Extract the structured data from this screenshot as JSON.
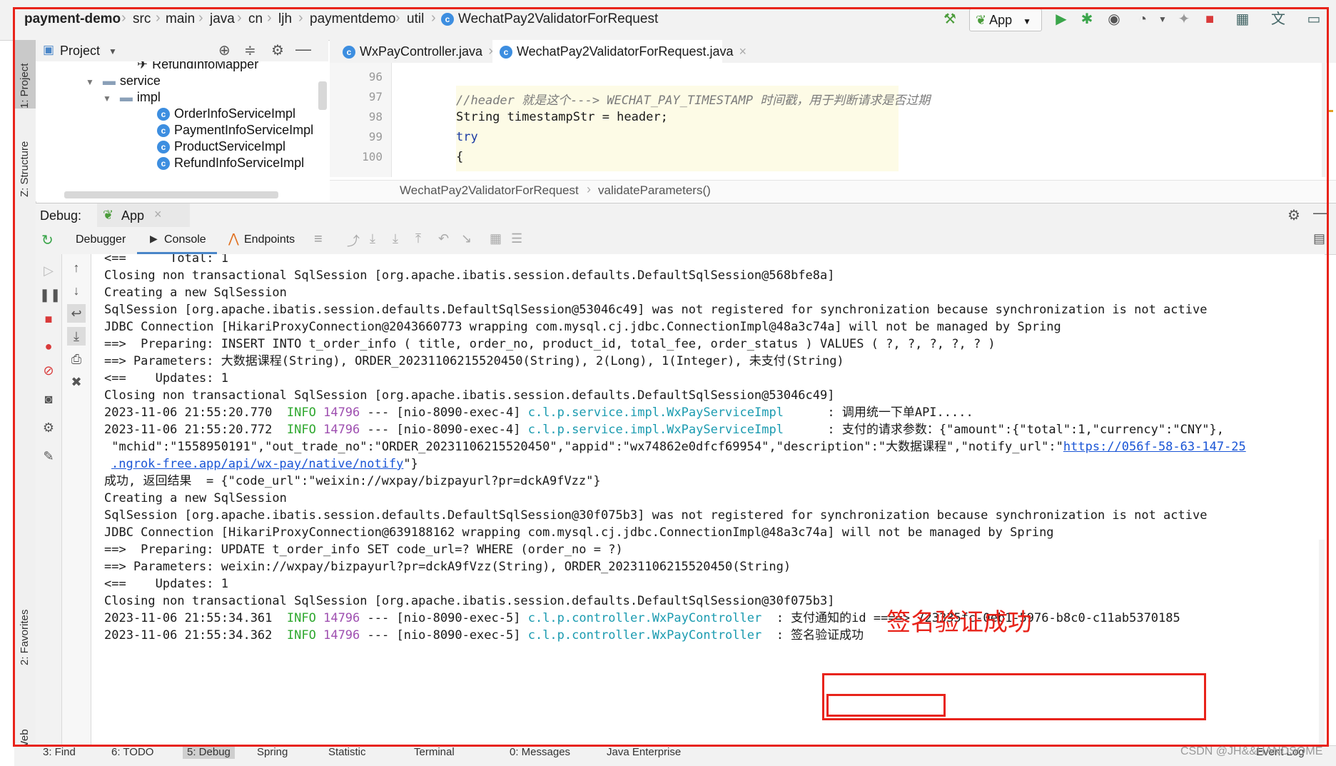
{
  "breadcrumb": [
    "payment-demo",
    "src",
    "main",
    "java",
    "cn",
    "ljh",
    "paymentdemo",
    "util",
    "WechatPay2ValidatorForRequest"
  ],
  "run_config": "App",
  "side_labels": {
    "project": "1: Project",
    "structure": "Z: Structure",
    "favorites": "2: Favorites",
    "web": "Web"
  },
  "project": {
    "header": "Project",
    "items": [
      {
        "label": "RefundInfoMapper",
        "kind": "mapper"
      },
      {
        "label": "service",
        "kind": "folder"
      },
      {
        "label": "impl",
        "kind": "folder"
      },
      {
        "label": "OrderInfoServiceImpl",
        "kind": "class"
      },
      {
        "label": "PaymentInfoServiceImpl",
        "kind": "class"
      },
      {
        "label": "ProductServiceImpl",
        "kind": "class"
      },
      {
        "label": "RefundInfoServiceImpl",
        "kind": "class"
      }
    ]
  },
  "editor": {
    "tabs": [
      "WxPayController.java",
      "WechatPay2ValidatorForRequest.java"
    ],
    "line_numbers": [
      "96",
      "97",
      "98",
      "99",
      "100"
    ],
    "code_lines": [
      "",
      "//header 就是这个---> WECHAT_PAY_TIMESTAMP 时间戳，用于判断请求是否过期",
      "String timestampStr = header;",
      "try",
      "{"
    ],
    "breadcrumb": [
      "WechatPay2ValidatorForRequest",
      "validateParameters()"
    ]
  },
  "debug": {
    "label": "Debug:",
    "session": "App",
    "tabs": [
      "Debugger",
      "Console",
      "Endpoints"
    ]
  },
  "console": {
    "lines": [
      "<==      Total: 1",
      "Closing non transactional SqlSession [org.apache.ibatis.session.defaults.DefaultSqlSession@568bfe8a]",
      "Creating a new SqlSession",
      "SqlSession [org.apache.ibatis.session.defaults.DefaultSqlSession@53046c49] was not registered for synchronization because synchronization is not active",
      "JDBC Connection [HikariProxyConnection@2043660773 wrapping com.mysql.cj.jdbc.ConnectionImpl@48a3c74a] will not be managed by Spring",
      "==>  Preparing: INSERT INTO t_order_info ( title, order_no, product_id, total_fee, order_status ) VALUES ( ?, ?, ?, ?, ? )",
      "==> Parameters: 大数据课程(String), ORDER_20231106215520450(String), 2(Long), 1(Integer), 未支付(String)",
      "<==    Updates: 1",
      "Closing non transactional SqlSession [org.apache.ibatis.session.defaults.DefaultSqlSession@53046c49]"
    ],
    "log1": {
      "time": "2023-11-06 21:55:20.770",
      "level": "INFO",
      "pid": "14796",
      "thread": "--- [nio-8090-exec-4]",
      "cls": "c.l.p.service.impl.WxPayServiceImpl",
      "msg": "      : 调用统一下单API....."
    },
    "log2": {
      "time": "2023-11-06 21:55:20.772",
      "level": "INFO",
      "pid": "14796",
      "thread": "--- [nio-8090-exec-4]",
      "cls": "c.l.p.service.impl.WxPayServiceImpl",
      "msg": "      : 支付的请求参数：{\"amount\":{\"total\":1,\"currency\":\"CNY\"},"
    },
    "json_cont": " \"mchid\":\"1558950191\",\"out_trade_no\":\"ORDER_20231106215520450\",\"appid\":\"wx74862e0dfcf69954\",\"description\":\"大数据课程\",\"notify_url\":\"",
    "json_link1": "https://056f-58-63-147-25",
    "json_link2": ".ngrok-free.app/api/wx-pay/native/notify",
    "json_tail": "\"}",
    "lines2": [
      "成功, 返回结果  = {\"code_url\":\"weixin://wxpay/bizpayurl?pr=dckA9fVzz\"}",
      "Creating a new SqlSession",
      "SqlSession [org.apache.ibatis.session.defaults.DefaultSqlSession@30f075b3] was not registered for synchronization because synchronization is not active",
      "JDBC Connection [HikariProxyConnection@639188162 wrapping com.mysql.cj.jdbc.ConnectionImpl@48a3c74a] will not be managed by Spring",
      "==>  Preparing: UPDATE t_order_info SET code_url=? WHERE (order_no = ?)",
      "==> Parameters: weixin://wxpay/bizpayurl?pr=dckA9fVzz(String), ORDER_20231106215520450(String)",
      "<==    Updates: 1",
      "Closing non transactional SqlSession [org.apache.ibatis.session.defaults.DefaultSqlSession@30f075b3]"
    ],
    "log3": {
      "time": "2023-11-06 21:55:34.361",
      "level": "INFO",
      "pid": "14796",
      "thread": "--- [nio-8090-exec-5]",
      "cls": "c.l.p.controller.WxPayController",
      "msg": "  : 支付通知的id ====> 723335fc-0eb1-5976-b8c0-c11ab5370185"
    },
    "log4": {
      "time": "2023-11-06 21:55:34.362",
      "level": "INFO",
      "pid": "14796",
      "thread": "--- [nio-8090-exec-5]",
      "cls": "c.l.p.controller.WxPayController",
      "msg": "  : 签名验证成功"
    }
  },
  "annotation": "签名验证成功",
  "bottom_tabs": [
    "3: Find",
    "6: TODO",
    "5: Debug",
    "Spring",
    "Statistic",
    "Terminal",
    "0: Messages",
    "Java Enterprise",
    "Event Log"
  ],
  "watermark": "CSDN @JH&&HANDSOME",
  "colors": {
    "annotation": "#e8231a",
    "box": "#e8231a",
    "info": "#2fa82f",
    "class": "#1b9bb0",
    "link": "#1a55d6"
  }
}
